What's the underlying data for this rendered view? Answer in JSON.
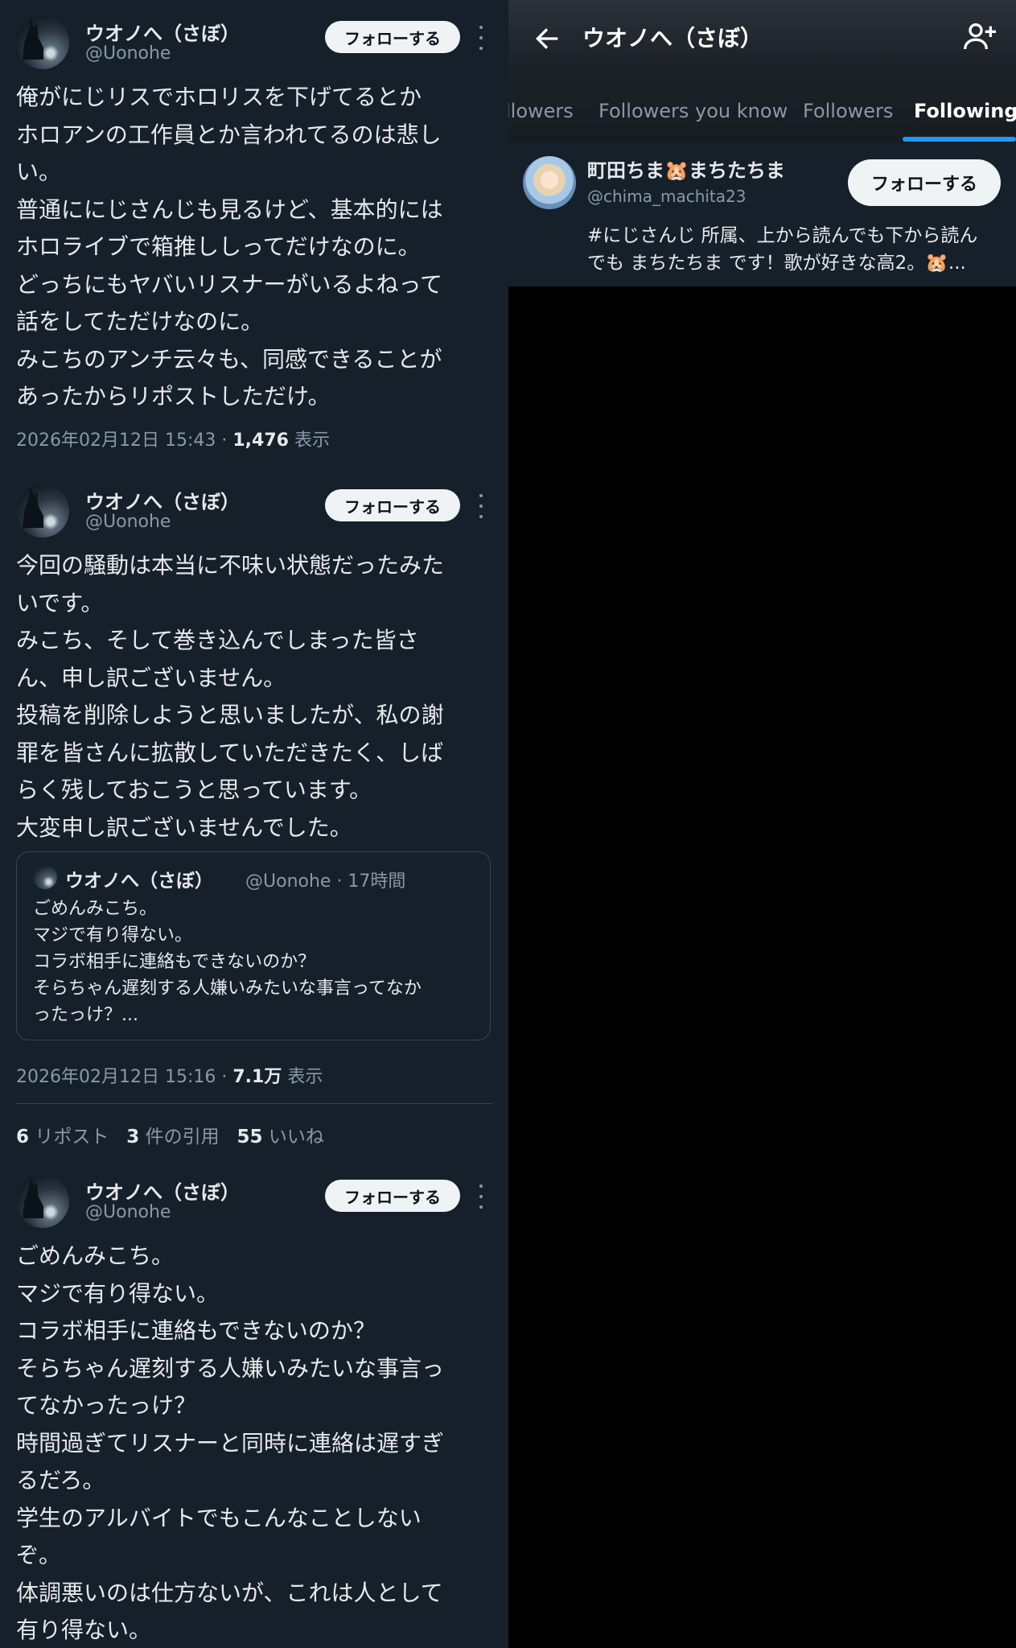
{
  "left": {
    "tweets": [
      {
        "name": "ウオノへ（さぼ）",
        "handle": "@Uonohe",
        "follow_label": "フォローする",
        "lines": [
          "俺がにじリスでホロリスを下げてるとか",
          "ホロアンの工作員とか言われてるのは悲し",
          "い。",
          "普通ににじさんじも見るけど、基本的には",
          "ホロライブで箱推ししってだけなのに。",
          "どっちにもヤバいリスナーがいるよねって",
          "話をしてただけなのに。",
          "みこちのアンチ云々も、同感できることが",
          "あったからリポストしただけ。"
        ],
        "timestamp": "2026年02月12日 15:43 · ",
        "views": "1,476",
        "views_label": " 表示"
      },
      {
        "name": "ウオノへ（さぼ）",
        "handle": "@Uonohe",
        "follow_label": "フォローする",
        "lines": [
          "今回の騒動は本当に不味い状態だったみた",
          "いです。",
          "みこち、そして巻き込んでしまった皆さ",
          "ん、申し訳ございません。",
          "投稿を削除しようと思いましたが、私の謝",
          "罪を皆さんに拡散していただきたく、しば",
          "らく残しておこうと思っています。",
          "大変申し訳ございませんでした。"
        ],
        "quote": {
          "name": "ウオノへ（さぼ）",
          "meta": "@Uonohe · 17時間",
          "lines": [
            "ごめんみこち。",
            "マジで有り得ない。",
            "コラボ相手に連絡もできないのか？",
            "そらちゃん遅刻する人嫌いみたいな事言ってなか",
            "ったっけ？..."
          ]
        },
        "timestamp": "2026年02月12日 15:16 · ",
        "views": "7.1万",
        "views_label": " 表示",
        "stats": {
          "reposts": "6",
          "reposts_label": " リポスト",
          "quotes": "3",
          "quotes_label": " 件の引用",
          "likes": "55",
          "likes_label": " いいね"
        }
      },
      {
        "name": "ウオノへ（さぼ）",
        "handle": "@Uonohe",
        "follow_label": "フォローする",
        "lines": [
          "ごめんみこち。",
          "マジで有り得ない。",
          "コラボ相手に連絡もできないのか？",
          "そらちゃん遅刻する人嫌いみたいな事言っ",
          "てなかったっけ？",
          "時間過ぎてリスナーと同時に連絡は遅すぎ",
          "るだろ。",
          "学生のアルバイトでもこんなことしない",
          "ぞ。",
          "体調悪いのは仕方ないが、これは人として",
          "有り得ない。"
        ]
      }
    ]
  },
  "right": {
    "title": "ウオノへ（さぼ）",
    "tabs": [
      "llowers",
      "Followers you know",
      "Followers",
      "Following"
    ],
    "active_tab": "Following",
    "user": {
      "name": "町田ちま🐹まちたちま",
      "handle": "@chima_machita23",
      "follow_label": "フォローする",
      "bio_lines": [
        "#にじさんじ 所属、上から読んでも下から読ん",
        "でも まちたちま です！歌が好きな高2。🐹..."
      ]
    }
  },
  "colors": {
    "background": "#15202b",
    "accent": "#1d9bf0",
    "muted_text": "#8b98a5",
    "text": "#e7e9ea"
  }
}
